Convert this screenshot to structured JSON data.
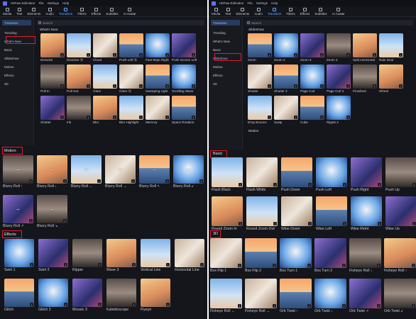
{
  "app": {
    "name": "HitPaw Edimakor",
    "menus": [
      "File",
      "Settings",
      "Help"
    ]
  },
  "toolbar": {
    "items": [
      "Media",
      "Text",
      "Elements",
      "Audio",
      "Transition",
      "Filters",
      "Effects",
      "Subtitles",
      "AI Avatar"
    ]
  },
  "left_window": {
    "sidebar_header": "Transition",
    "sidebar_items": [
      "Trending",
      "What's New",
      "Basic",
      "Slideshow",
      "Motion",
      "Effects",
      "3D"
    ],
    "selected_item": "What's New",
    "search_placeholder": "Search",
    "section_title": "What's New",
    "thumbs": [
      "Dissolve",
      "Dissolve ⑫",
      "Cloud",
      "Push Left ⑫",
      "Fast Wipe Right",
      "Push Screen Left",
      "Pull In",
      "Pull Out",
      "Glare",
      "Glare ⑫",
      "Sweeping Light",
      "Scrolling Wave",
      "Shutter",
      "Ink",
      "Blur",
      "Blur Highlight",
      "Memory",
      "Space Rotation"
    ]
  },
  "right_window": {
    "sidebar_header": "Transition",
    "sidebar_items": [
      "Trending",
      "What's New",
      "Basic",
      "Slideshow",
      "Motion",
      "Effects",
      "3D"
    ],
    "selected_item": "Slideshow",
    "search_placeholder": "Search",
    "section_title": "Slideshow",
    "thumbs": [
      "Zoom",
      "Zoom 2",
      "Zoom 3",
      "Zoom 4",
      "Split Horizontal",
      "Rain Door",
      "Shutter",
      "Shutter 2",
      "Page Curl",
      "Page Curl 2",
      "Pinwheel",
      "Wheel",
      "Drop Bounce",
      "Swap",
      "Cube",
      "Ripple 2"
    ],
    "next_section_title": "Motion"
  },
  "panels": {
    "motion": {
      "title": "Motion",
      "items": [
        "Blurry Roll ↑",
        "Blurry Roll ↓",
        "Blurry Roll ←",
        "Blurry Roll →",
        "Blurry Roll ↖",
        "Blurry Roll ↙",
        "Blurry Roll ↗",
        "Blurry Roll ↘"
      ]
    },
    "basic": {
      "title": "Basic",
      "items": [
        "Flash Black",
        "Flash White",
        "Push Down",
        "Push Left",
        "Push Right",
        "Push Up",
        "Round Zoom In",
        "Round Zoom Out",
        "Wipe Down",
        "Wipe Left",
        "Wipe Right",
        "Wipe Up"
      ]
    },
    "effects": {
      "title": "Effects",
      "items": [
        "Swirl 1",
        "Swirl 2",
        "Ripper",
        "Wave 3",
        "Vertical Line",
        "Horizontal Line",
        "Glitch",
        "Glitch 2",
        "Mosaic 3",
        "Kaleidoscope",
        "Flyeye"
      ]
    },
    "three_d": {
      "title": "3D",
      "items": [
        "Box Flip 1",
        "Box Flip 2",
        "Box Turn 1",
        "Box Turn 2",
        "Fisheye Roll ↓",
        "Fisheye Roll ↑",
        "Fisheye Roll ←",
        "Fisheye Roll →",
        "Orb Twist ↑",
        "Orb Twist ↓",
        "Orb Twist ↗",
        "Orb Twist ↙"
      ]
    }
  },
  "colors": {
    "background": "#14161c",
    "accent": "#5fa9ff",
    "highlight_box": "#e11d2a"
  }
}
